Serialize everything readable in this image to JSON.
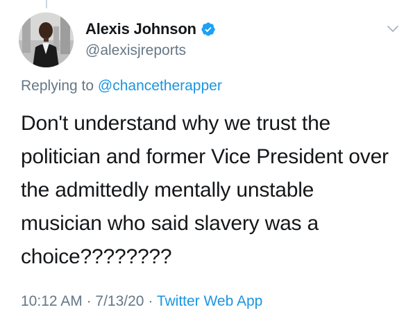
{
  "tweet": {
    "author": {
      "display_name": "Alexis Johnson",
      "handle": "@alexisjreports",
      "avatar_icon": "avatar-photo",
      "verified_icon": "verified-badge-icon"
    },
    "reply": {
      "prefix": "Replying to",
      "mention": "@chancetherapper"
    },
    "text": "Don't understand why we trust the politician and former Vice President over the admittedly mentally unstable musician who said slavery was a choice????????",
    "meta": {
      "time": "10:12 AM",
      "separator": "·",
      "date": "7/13/20",
      "source": "Twitter Web App"
    },
    "menu_icon": "chevron-down-icon"
  },
  "colors": {
    "primary_text": "#14171a",
    "secondary_text": "#657786",
    "link": "#1b95e0",
    "verified": "#1da1f2"
  }
}
